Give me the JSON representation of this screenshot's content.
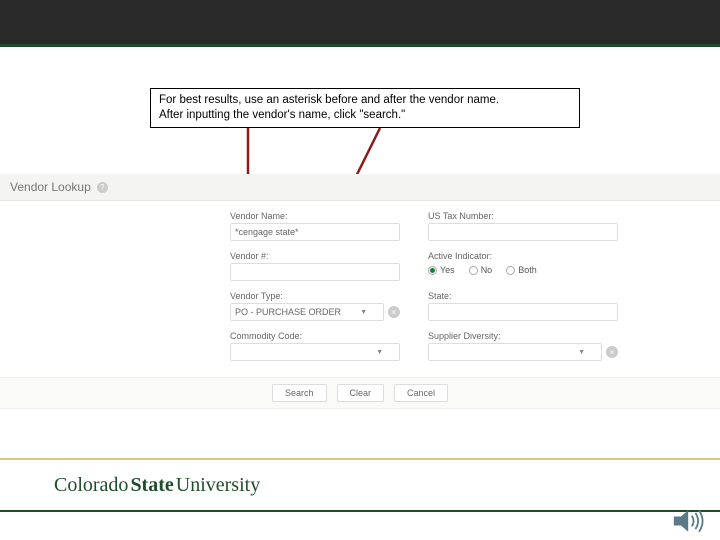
{
  "callout": {
    "line1": "For best results, use an asterisk before and after the vendor name.",
    "line2": "After inputting the vendor's name, click \"search.\""
  },
  "page": {
    "title": "Vendor Lookup"
  },
  "form": {
    "vendor_name": {
      "label": "Vendor Name:",
      "value": "*cengage state*"
    },
    "us_tax": {
      "label": "US Tax Number:",
      "value": ""
    },
    "vendor_num_2": {
      "label": "Vendor #:",
      "value": ""
    },
    "active_indicator": {
      "label": "Active Indicator:",
      "options": {
        "yes": "Yes",
        "no": "No",
        "both": "Both"
      },
      "selected": "yes"
    },
    "vendor_type": {
      "label": "Vendor Type:",
      "value": "PO - PURCHASE ORDER"
    },
    "state": {
      "label": "State:",
      "value": ""
    },
    "commodity_code": {
      "label": "Commodity Code:",
      "value": ""
    },
    "supplier_diversity": {
      "label": "Supplier Diversity:",
      "value": ""
    }
  },
  "buttons": {
    "search": "Search",
    "clear": "Clear",
    "cancel": "Cancel"
  },
  "footer": {
    "brand_part1": "Colorado",
    "brand_part2": "State",
    "brand_part3": "University"
  }
}
